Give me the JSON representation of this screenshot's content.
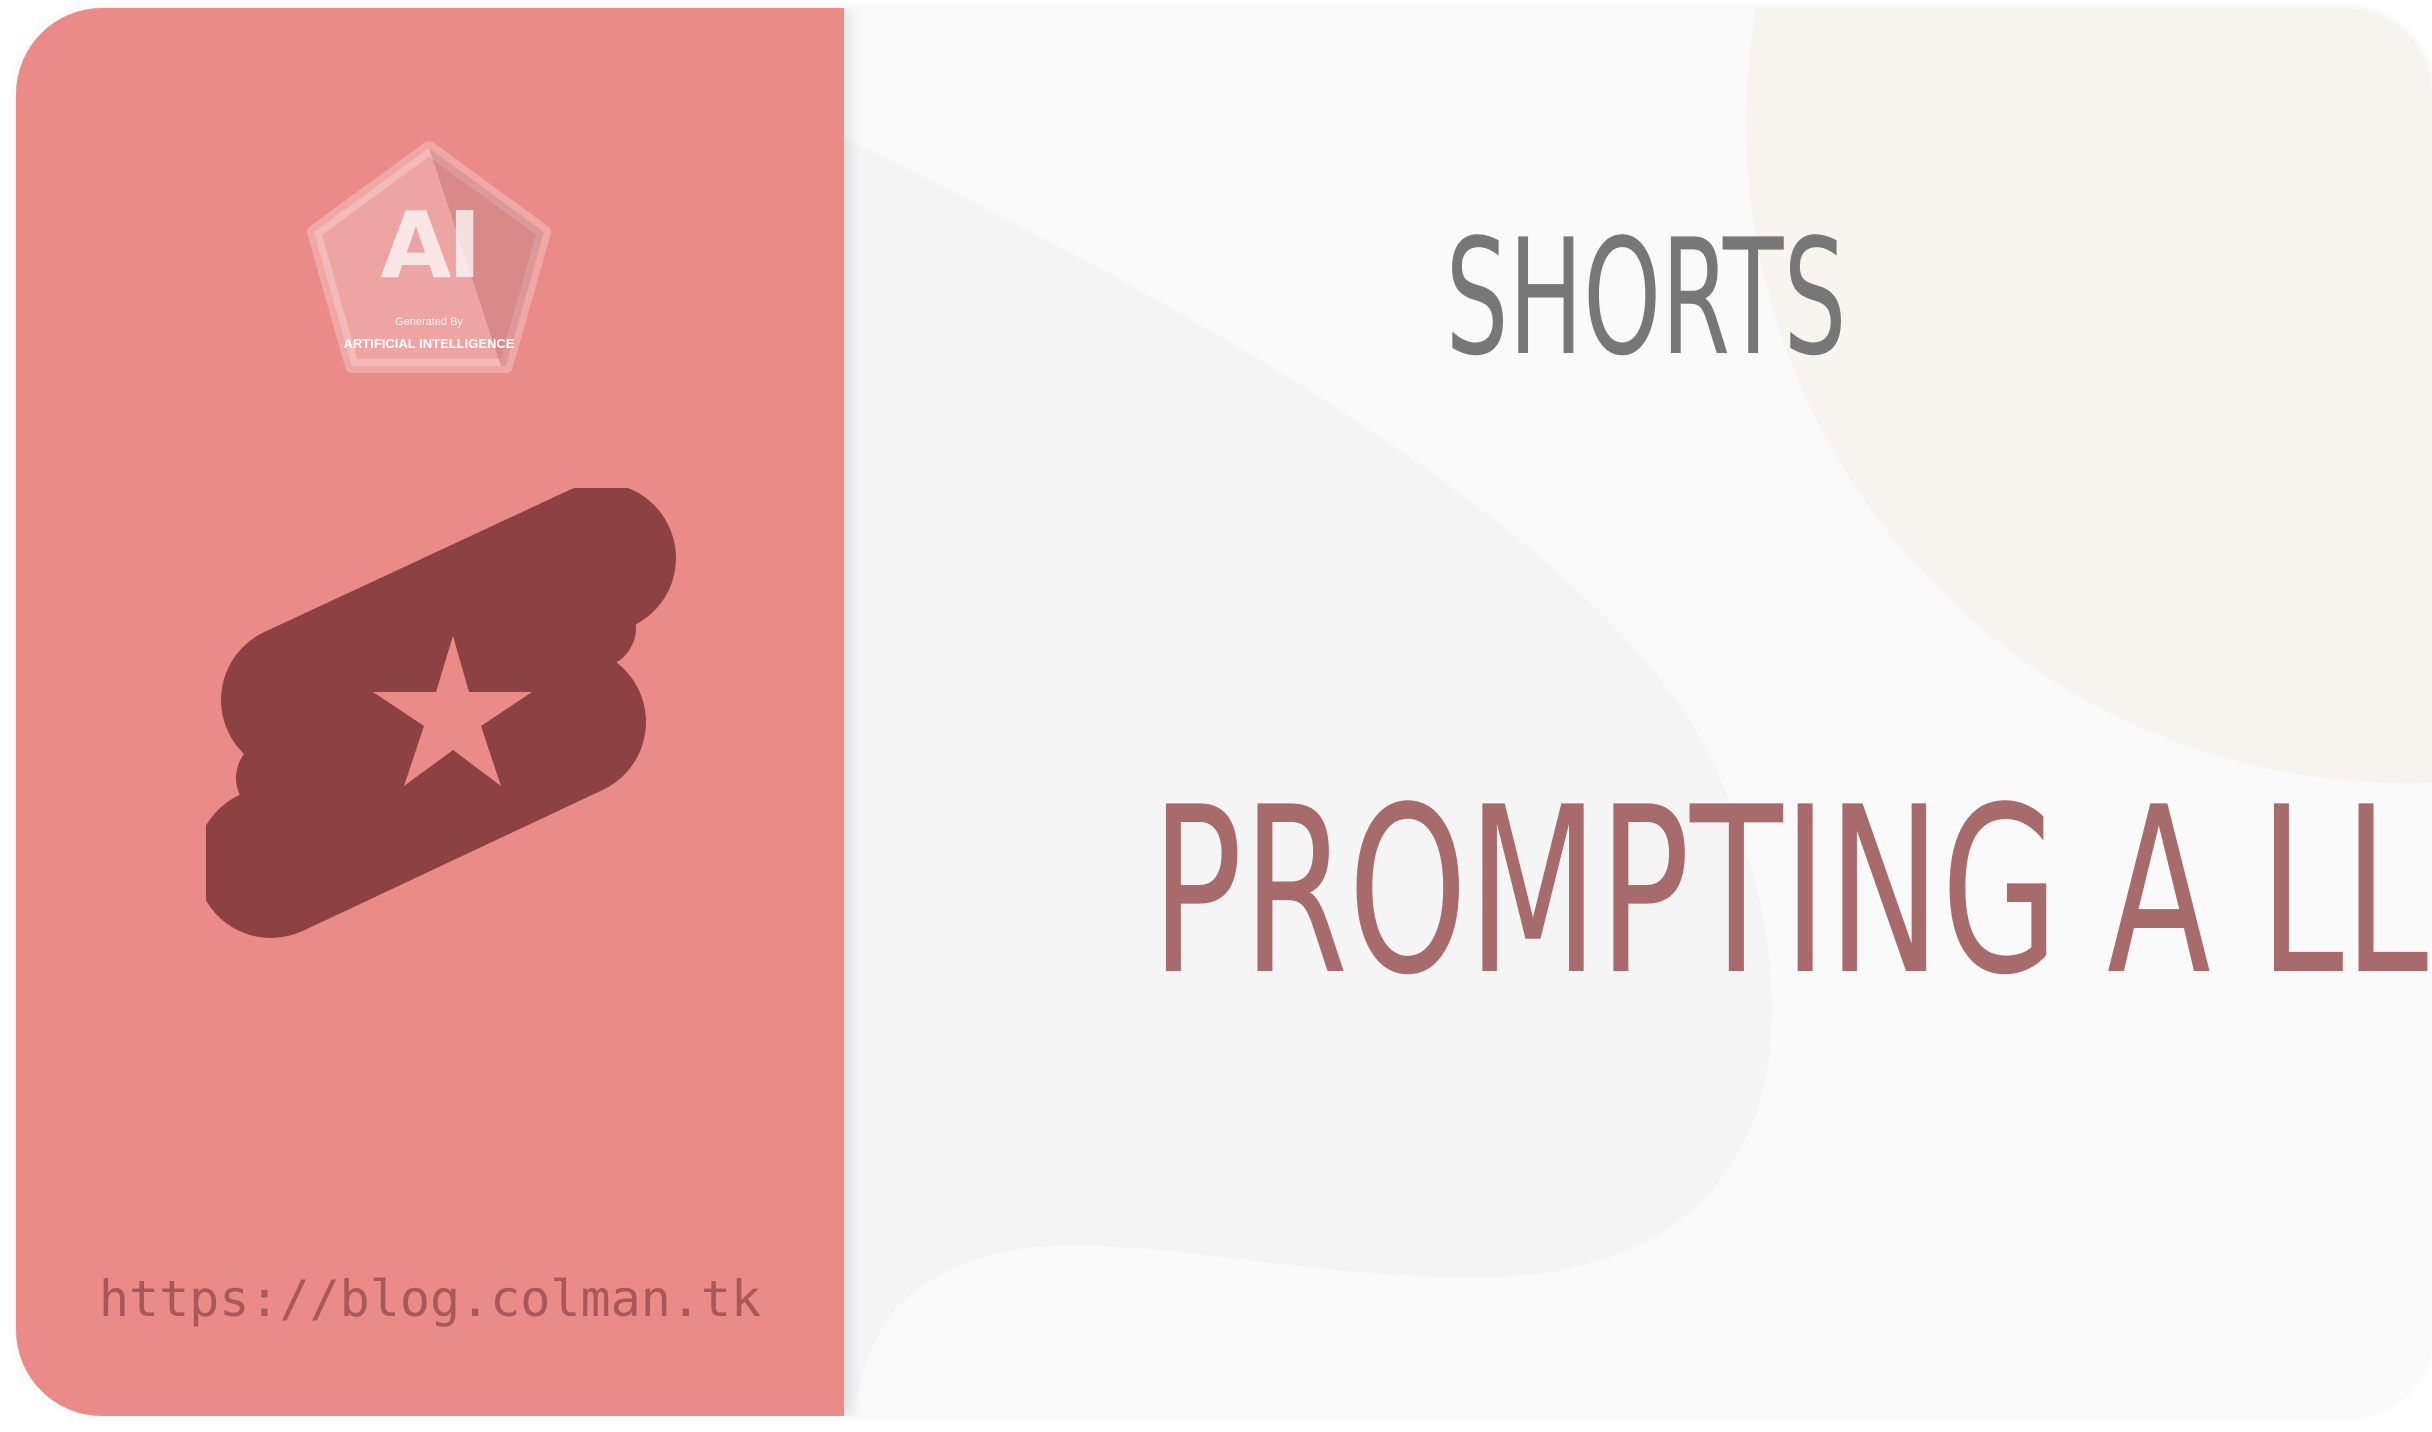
{
  "badge": {
    "title": "AI",
    "line1": "Generated By",
    "line2": "ARTIFICIAL INTELLIGENCE"
  },
  "icons": {
    "logo": "shorts-logo-icon",
    "badge": "pentagon-badge-icon"
  },
  "colors": {
    "left_panel": "#ea8b88",
    "logo": "#8c4242",
    "category_text": "#777777",
    "title_text": "#a76b6c",
    "url_text": "#a9585a"
  },
  "category": "SHORTS",
  "title": "PROMPTING A LLM",
  "url": "https://blog.colman.tk"
}
